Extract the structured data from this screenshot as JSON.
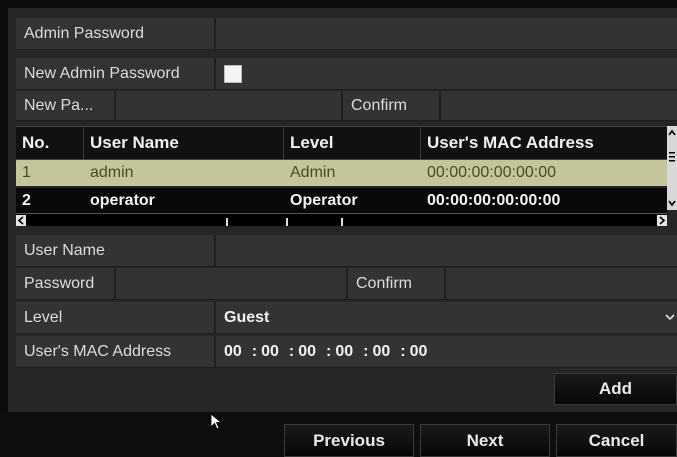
{
  "admin": {
    "section_label": "Admin Password",
    "new_password_label": "New Admin Password",
    "new_password_checked": true,
    "new_password_short_label": "New Pa...",
    "confirm_label": "Confirm"
  },
  "users_table": {
    "columns": [
      "No.",
      "User Name",
      "Level",
      "User's MAC Address"
    ],
    "rows": [
      {
        "no": "1",
        "user_name": "admin",
        "level": "Admin",
        "mac": "00:00:00:00:00:00",
        "selected": true
      },
      {
        "no": "2",
        "user_name": "operator",
        "level": "Operator",
        "mac": "00:00:00:00:00:00",
        "selected": false
      }
    ]
  },
  "form": {
    "user_name_label": "User Name",
    "password_label": "Password",
    "confirm_label": "Confirm",
    "level_label": "Level",
    "level_value": "Guest",
    "mac_label": "User's MAC Address",
    "mac_octets": [
      "00",
      "00",
      "00",
      "00",
      "00",
      "00"
    ]
  },
  "buttons": {
    "add": "Add",
    "previous": "Previous",
    "next": "Next",
    "cancel": "Cancel"
  },
  "colors": {
    "selected_row": "#c4c59a",
    "panel": "#262626"
  }
}
